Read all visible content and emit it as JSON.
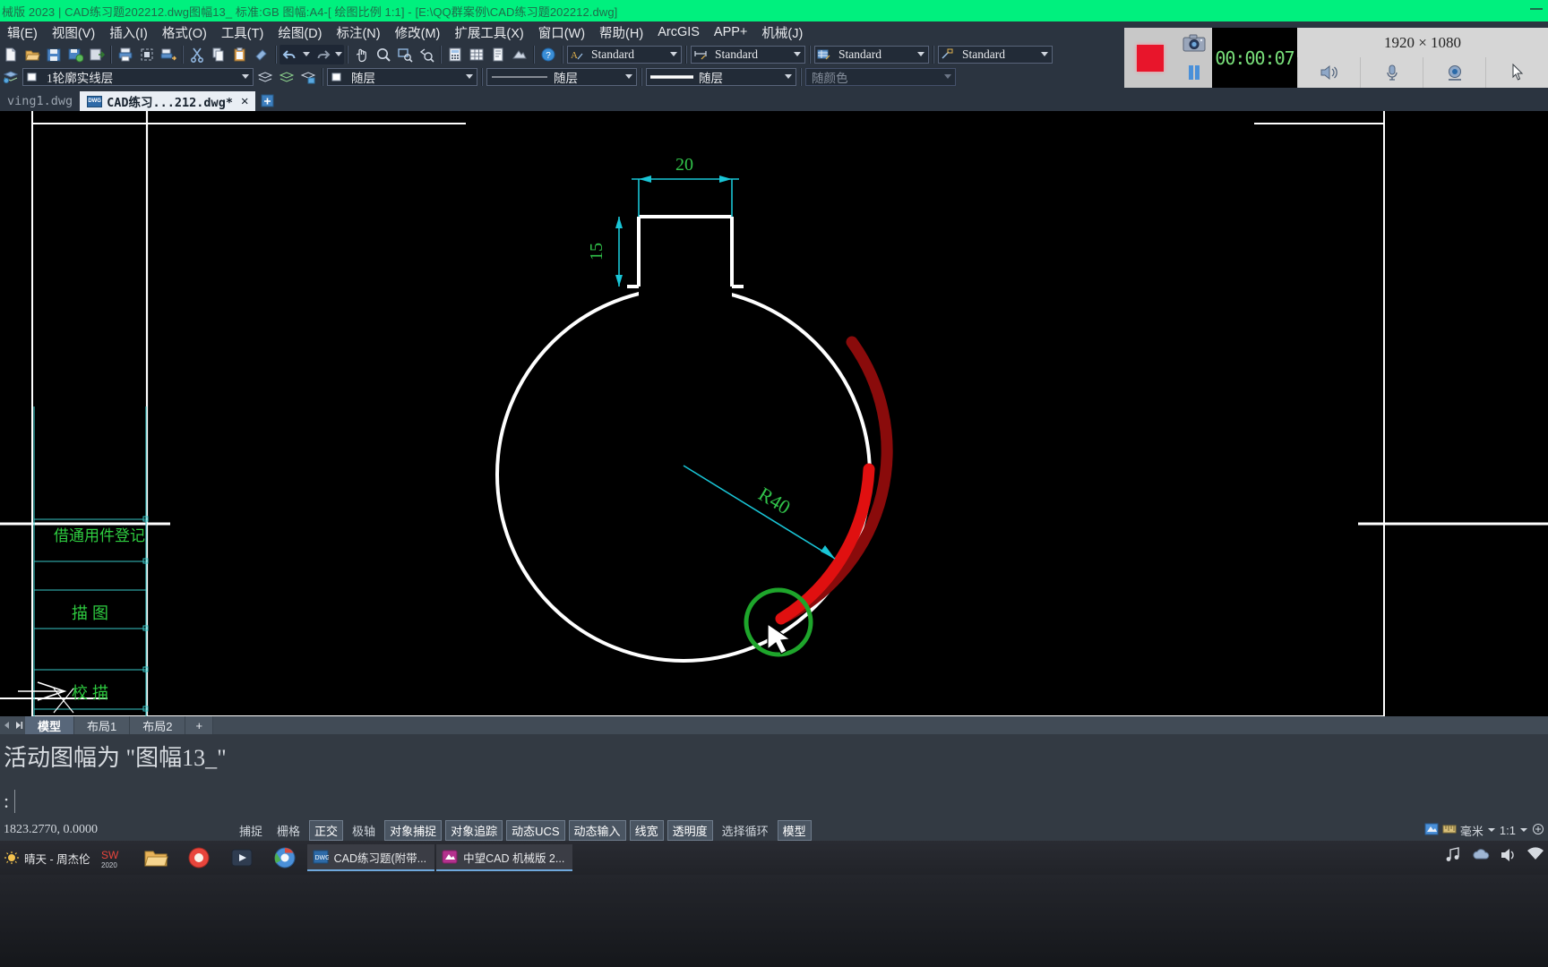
{
  "window": {
    "title": "械版 2023 | CAD练习题202212.dwg图幅13_ 标准:GB 图幅:A4-[ 绘图比例 1:1] - [E:\\QQ群案例\\CAD练习题202212.dwg]",
    "minimize_label": "—"
  },
  "menu": {
    "items": [
      {
        "label": "辑(E)"
      },
      {
        "label": "视图(V)"
      },
      {
        "label": "插入(I)"
      },
      {
        "label": "格式(O)"
      },
      {
        "label": "工具(T)"
      },
      {
        "label": "绘图(D)"
      },
      {
        "label": "标注(N)"
      },
      {
        "label": "修改(M)"
      },
      {
        "label": "扩展工具(X)"
      },
      {
        "label": "窗口(W)"
      },
      {
        "label": "帮助(H)"
      },
      {
        "label": "ArcGIS"
      },
      {
        "label": "APP+"
      },
      {
        "label": "机械(J)"
      }
    ]
  },
  "toolbar": {
    "text_style": "Standard",
    "dim_style": "Standard",
    "table_style": "Standard",
    "mleader_style": "Standard",
    "layer": "1轮廓实线层",
    "color": "随层",
    "linetype": "随层",
    "lineweight": "随层",
    "plotstyle": "随颜色",
    "icons": [
      "new-file-icon",
      "open-file-icon",
      "save-icon",
      "save-as-icon",
      "export-icon",
      "print-icon",
      "print-preview-icon",
      "plot-icon",
      "cut-icon",
      "copy-icon",
      "paste-icon",
      "match-properties-icon",
      "undo-icon",
      "redo-icon",
      "pan-icon",
      "zoom-realtime-icon",
      "zoom-window-icon",
      "zoom-previous-icon",
      "calculator-icon",
      "table-icon",
      "document-icon",
      "render-icon",
      "help-icon"
    ]
  },
  "recorder": {
    "timer": "00:00:07",
    "resolution": "1920 × 1080",
    "stop_label": "stop-record-button",
    "icons": [
      "camera-icon",
      "pause-icon",
      "speaker-icon",
      "microphone-icon",
      "webcam-icon",
      "cursor-icon"
    ]
  },
  "doc_tabs": {
    "items": [
      {
        "label": "ving1.dwg",
        "active": false,
        "closable": false
      },
      {
        "label": "CAD练习...212.dwg*",
        "active": true,
        "closable": true
      }
    ],
    "new_tab_label": "+"
  },
  "layout_tabs": {
    "items": [
      {
        "label": "模型",
        "active": true
      },
      {
        "label": "布局1",
        "active": false
      },
      {
        "label": "布局2",
        "active": false
      },
      {
        "label": "+",
        "active": false
      }
    ]
  },
  "command": {
    "history": "活动图幅为 \"图幅13_\"",
    "prompt": ":",
    "input_value": ""
  },
  "status": {
    "coordinates": "1823.2770,  0.0000",
    "toggles": [
      {
        "label": "捕捉",
        "on": false
      },
      {
        "label": "栅格",
        "on": false
      },
      {
        "label": "正交",
        "on": true
      },
      {
        "label": "极轴",
        "on": false
      },
      {
        "label": "对象捕捉",
        "on": true
      },
      {
        "label": "对象追踪",
        "on": true
      },
      {
        "label": "动态UCS",
        "on": true
      },
      {
        "label": "动态输入",
        "on": true
      },
      {
        "label": "线宽",
        "on": true
      },
      {
        "label": "透明度",
        "on": true
      },
      {
        "label": "选择循环",
        "on": false
      },
      {
        "label": "模型",
        "on": true
      }
    ],
    "units": "毫米",
    "scale": "1:1"
  },
  "taskbar": {
    "weather": "晴天 - 周杰伦",
    "apps": [
      {
        "name": "solidworks-icon"
      },
      {
        "name": "file-explorer-icon"
      },
      {
        "name": "browser-icon"
      },
      {
        "name": "media-icon"
      }
    ],
    "windows": [
      {
        "label": "CAD练习题(附带...",
        "icon": "dwg-icon"
      },
      {
        "label": "中望CAD 机械版 2...",
        "icon": "zwcad-icon"
      }
    ],
    "tray": [
      "music-icon",
      "cloud-icon",
      "volume-icon",
      "network-icon"
    ]
  },
  "drawing": {
    "dim_width": "20",
    "dim_height": "15",
    "dim_radius": "R40",
    "titleblock": [
      {
        "text": "借通用件登记"
      },
      {
        "text": "描  图"
      },
      {
        "text": "校  描"
      }
    ],
    "colors": {
      "outline": "#ffffff",
      "dimension": "#19c5d6",
      "dim_text": "#31c34a",
      "selected_arc": "#e01010",
      "selected_arc_dark": "#8a0b0b",
      "snap_marker": "#1ea52b",
      "titleblock_line": "#39c6c6",
      "titleblock_text": "#2ecc40"
    }
  }
}
